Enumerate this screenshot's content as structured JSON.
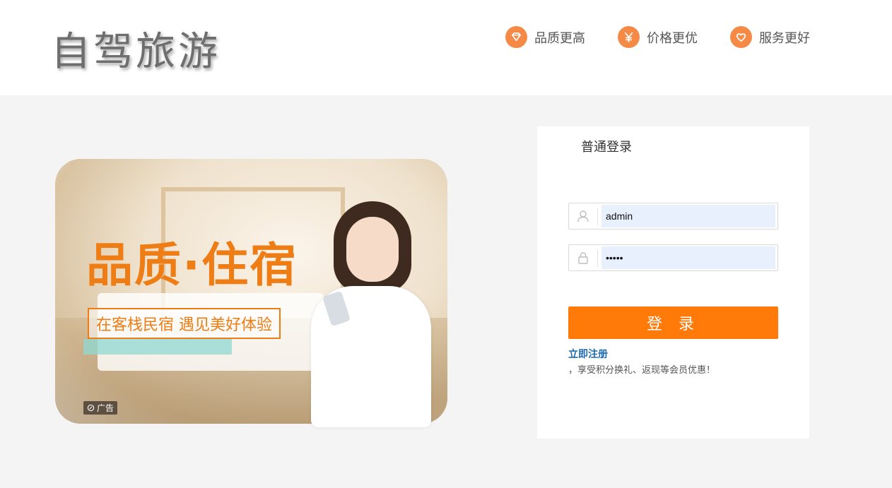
{
  "header": {
    "logo_text": "自驾旅游",
    "features": [
      {
        "label": "品质更高",
        "icon": "diamond-icon"
      },
      {
        "label": "价格更优",
        "icon": "yen-icon"
      },
      {
        "label": "服务更好",
        "icon": "heart-icon"
      }
    ],
    "accent_color": "#f58a46"
  },
  "banner": {
    "title": "品质·住宿",
    "subtitle": "在客栈民宿 遇见美好体验",
    "ad_label": "广告"
  },
  "login": {
    "tab_label": "普通登录",
    "username_value": "admin",
    "password_value": "•••••",
    "submit_label": "登 录",
    "register_link": "立即注册",
    "register_desc": "，享受积分换礼、返现等会员优惠！",
    "button_color": "#ff7a08"
  }
}
